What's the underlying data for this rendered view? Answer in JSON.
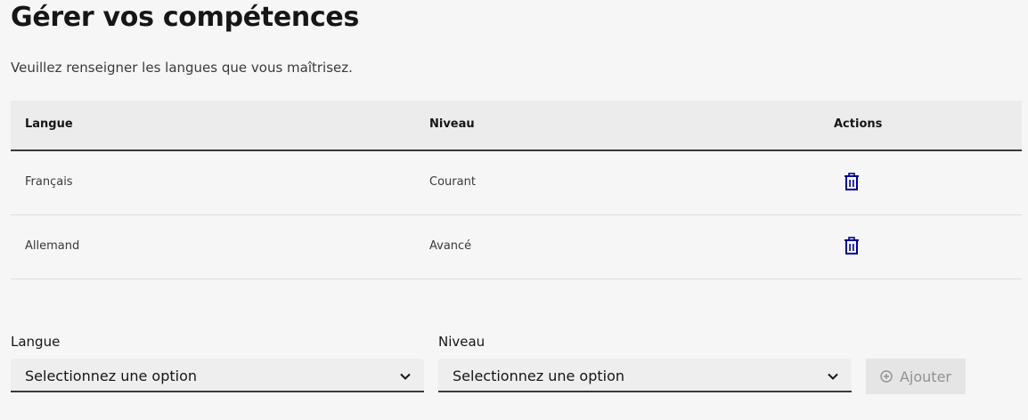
{
  "page": {
    "title": "Gérer vos compétences",
    "intro": "Veuillez renseigner les langues que vous maîtrisez."
  },
  "table": {
    "headers": {
      "langue": "Langue",
      "niveau": "Niveau",
      "actions": "Actions"
    },
    "rows": [
      {
        "langue": "Français",
        "niveau": "Courant",
        "action_icon": "trash-icon"
      },
      {
        "langue": "Allemand",
        "niveau": "Avancé",
        "action_icon": "trash-icon"
      }
    ]
  },
  "form": {
    "langue_label": "Langue",
    "langue_value": "Selectionnez une option",
    "niveau_label": "Niveau",
    "niveau_value": "Selectionnez une option",
    "add_label": "Ajouter",
    "add_icon": "add-circle-icon"
  },
  "colors": {
    "background": "#f6f6f6",
    "table_header": "#ececec",
    "icon_blue": "#000091",
    "disabled_text": "#929292"
  }
}
